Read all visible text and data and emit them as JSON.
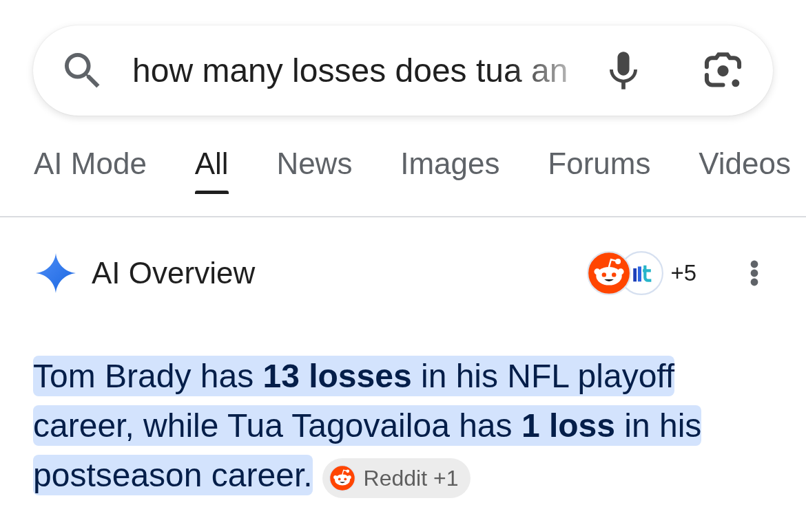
{
  "search": {
    "value": "how many losses does tua an"
  },
  "tabs": [
    {
      "label": "AI Mode",
      "selected": false
    },
    {
      "label": "All",
      "selected": true
    },
    {
      "label": "News",
      "selected": false
    },
    {
      "label": "Images",
      "selected": false
    },
    {
      "label": "Forums",
      "selected": false
    },
    {
      "label": "Videos",
      "selected": false
    }
  ],
  "ai_overview": {
    "title": "AI Overview",
    "source_count": "+5",
    "answer": {
      "text": "Tom Brady has **13 losses** in his NFL playoff career, while Tua Tagovailoa has **1 loss** in his postseason career.",
      "highlighted": true
    },
    "source_chip": {
      "label": "Reddit +1"
    }
  }
}
